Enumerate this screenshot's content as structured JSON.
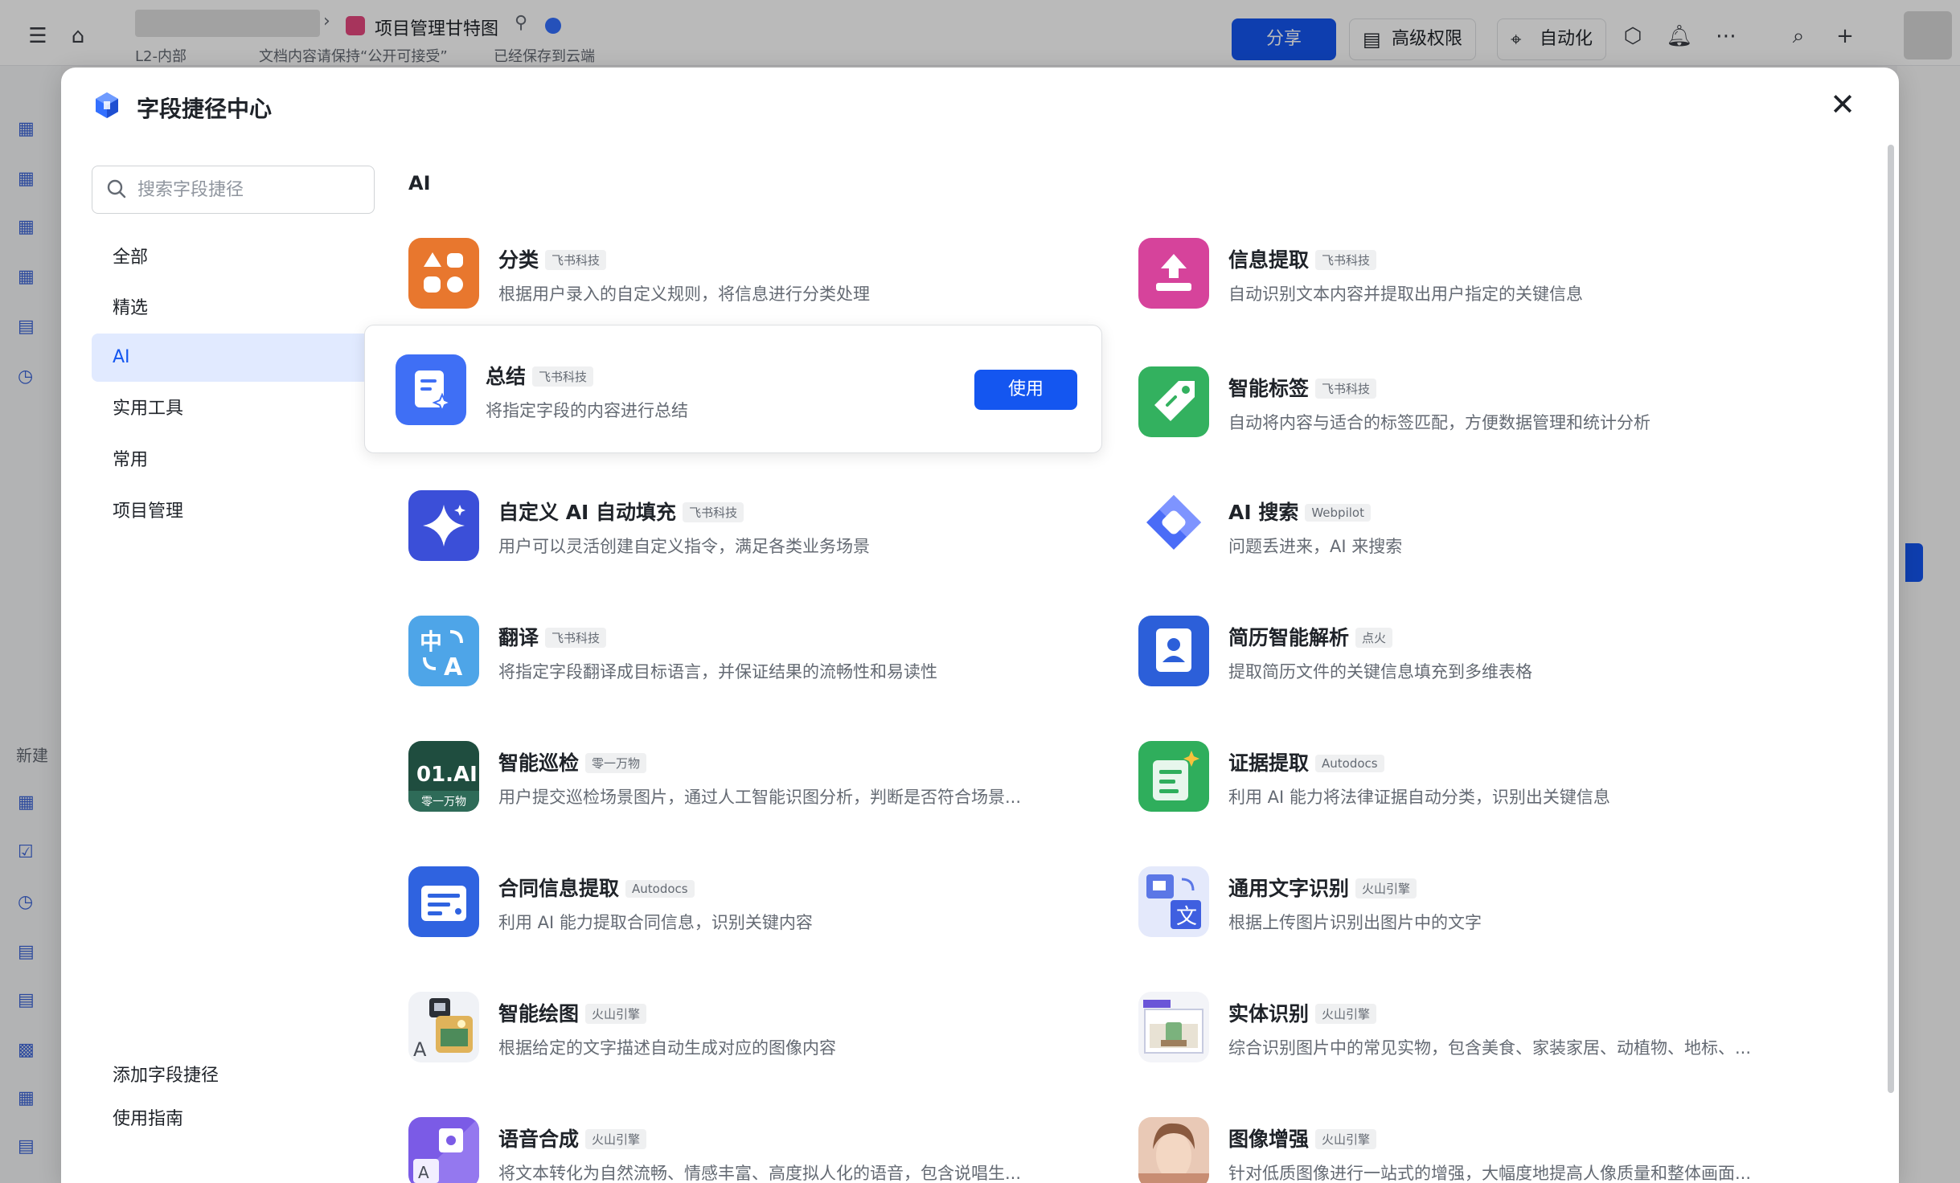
{
  "topbar": {
    "doc_title": "项目管理甘特图",
    "meta_security": "L2-内部",
    "meta_notice": "文档内容请保持“公开可接受”",
    "meta_saved": "已经保存到云端",
    "share_label": "分享",
    "permission_label": "高级权限",
    "automation_label": "自动化"
  },
  "background_sidebar": {
    "new_label": "新建"
  },
  "modal": {
    "title": "字段捷径中心",
    "search_placeholder": "搜索字段捷径",
    "categories": [
      "全部",
      "精选",
      "AI",
      "实用工具",
      "常用",
      "项目管理"
    ],
    "active_category": "AI",
    "footer_links": [
      "添加字段捷径",
      "使用指南"
    ],
    "section_title": "AI",
    "use_button_label": "使用",
    "cards": [
      {
        "name": "分类",
        "tag": "飞书科技",
        "desc": "根据用户录入的自定义规则，将信息进行分类处理",
        "icon": "grid-shapes-icon",
        "color": "#e8772e"
      },
      {
        "name": "信息提取",
        "tag": "飞书科技",
        "desc": "自动识别文本内容并提取出用户指定的关键信息",
        "icon": "extract-tray-icon",
        "color": "#d6439b"
      },
      {
        "name": "总结",
        "tag": "飞书科技",
        "desc": "将指定字段的内容进行总结",
        "icon": "summary-doc-icon",
        "color": "#3f6ff5"
      },
      {
        "name": "智能标签",
        "tag": "飞书科技",
        "desc": "自动将内容与适合的标签匹配，方便数据管理和统计分析",
        "icon": "tag-icon",
        "color": "#33b15f"
      },
      {
        "name": "自定义 AI 自动填充",
        "tag": "飞书科技",
        "desc": "用户可以灵活创建自定义指令，满足各类业务场景",
        "icon": "sparkle-icon",
        "color": "#3b4fd8"
      },
      {
        "name": "AI 搜索",
        "tag": "Webpilot",
        "desc": "问题丢进来，AI 来搜索",
        "icon": "webpilot-logo-icon",
        "color": "#4a6cf7"
      },
      {
        "name": "翻译",
        "tag": "飞书科技",
        "desc": "将指定字段翻译成目标语言，并保证结果的流畅性和易读性",
        "icon": "translate-icon",
        "color": "#4ea5e8"
      },
      {
        "name": "简历智能解析",
        "tag": "点火",
        "desc": "提取简历文件的关键信息填充到多维表格",
        "icon": "resume-icon",
        "color": "#2c5fd9"
      },
      {
        "name": "智能巡检",
        "tag": "零一万物",
        "desc": "用户提交巡检场景图片，通过人工智能识图分析，判断是否符合场景...",
        "icon": "01ai-logo-icon",
        "color": "#1f4d3f"
      },
      {
        "name": "证据提取",
        "tag": "Autodocs",
        "desc": "利用 AI 能力将法律证据自动分类，识别出关键信息",
        "icon": "evidence-doc-icon",
        "color": "#2fae5c"
      },
      {
        "name": "合同信息提取",
        "tag": "Autodocs",
        "desc": "利用 AI 能力提取合同信息，识别关键内容",
        "icon": "contract-icon",
        "color": "#2f63e0"
      },
      {
        "name": "通用文字识别",
        "tag": "火山引擎",
        "desc": "根据上传图片识别出图片中的文字",
        "icon": "ocr-icon",
        "color": "#5b77e6"
      },
      {
        "name": "智能绘图",
        "tag": "火山引擎",
        "desc": "根据给定的文字描述自动生成对应的图像内容",
        "icon": "ai-drawing-icon",
        "color": "#e9eef6"
      },
      {
        "name": "实体识别",
        "tag": "火山引擎",
        "desc": "综合识别图片中的常见实物，包含美食、家装家居、动植物、地标、...",
        "icon": "entity-recognition-icon",
        "color": "#eef0f6"
      },
      {
        "name": "语音合成",
        "tag": "火山引擎",
        "desc": "将文本转化为自然流畅、情感丰富、高度拟人化的语音，包含说唱生...",
        "icon": "speech-synthesis-icon",
        "color": "#7b5be6"
      },
      {
        "name": "图像增强",
        "tag": "火山引擎",
        "desc": "针对低质图像进行一站式的增强，大幅度地提高人像质量和整体画面...",
        "icon": "image-enhance-icon",
        "color": "#c88d73"
      }
    ]
  }
}
